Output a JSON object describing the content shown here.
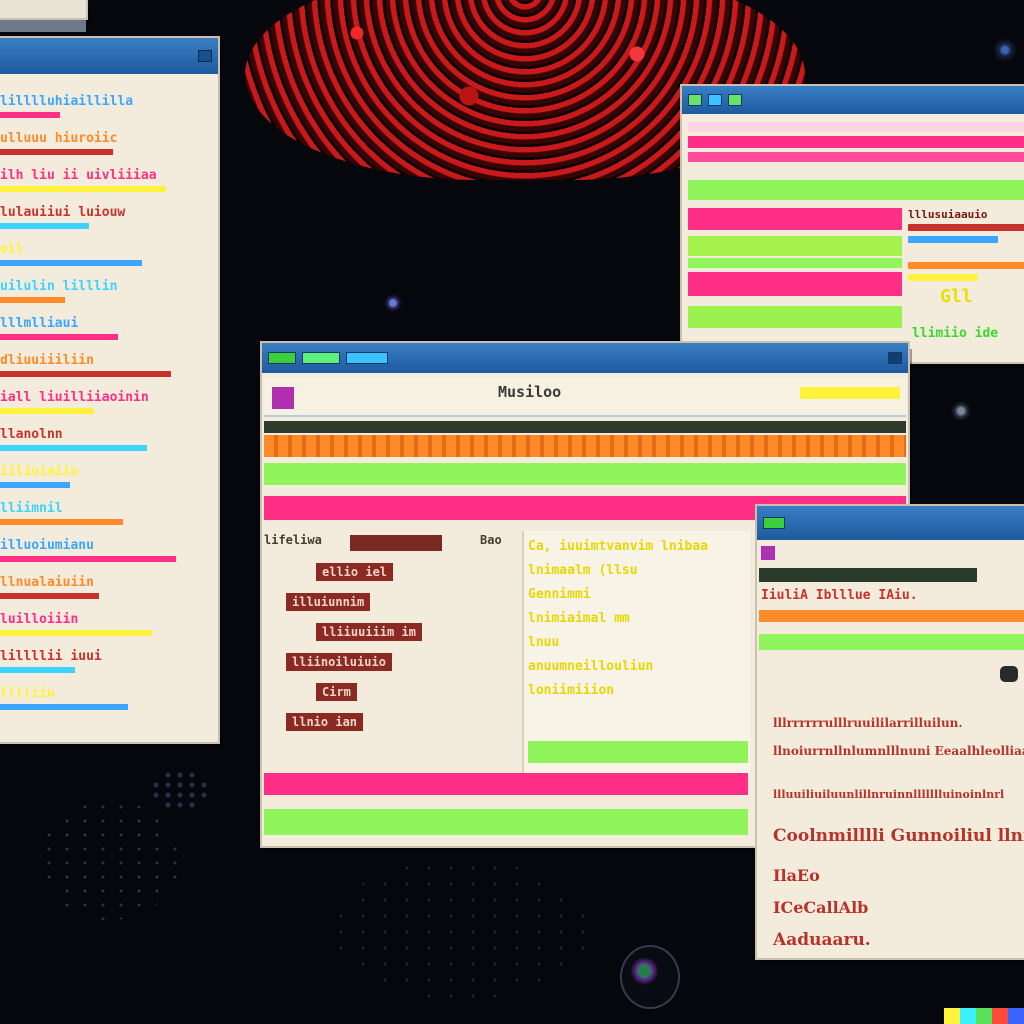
{
  "colors": {
    "desktop": "#05070d",
    "titlebar": "#2a6cb2",
    "pink": "#ff2e86",
    "green": "#8ff55a",
    "yellow": "#fff23a",
    "orange": "#ff8a2a",
    "red": "#c8322c",
    "cream": "#f3ecdc",
    "blue_text": "#3aa6ff"
  },
  "center_window": {
    "header_text": "Musiloo",
    "left_label": "lifeliwa",
    "right_label": "Bao",
    "yellow_rows": [
      "Ca, iuuimtvanvim lnibaa",
      "lnimaalm (llsu",
      "Gennimmi",
      "lnimiaimal mm",
      "lnuu",
      "anuumneillouliun",
      "loniimiiion"
    ],
    "red_rows": [
      "ellio iel",
      "illuiunnim",
      "lliiuuiiim im",
      "lliinoiluiuio",
      "Cirm",
      "llnio ian"
    ]
  },
  "right_top_window": {
    "label_1": "lllusuiaauio",
    "label_2": "Gll",
    "label_3": "llimiio ide"
  },
  "right_bottom_window": {
    "red_header": "IiuliA Iblllue IAiu.",
    "lines": [
      "lllrrrrrrulllruuililarrilluilun.",
      "llnoiurrnllnlumnlllnuni Eeaalhleolliaa",
      "llluuiliuiluunlillnruinnllllllluinoinlnrl",
      "Coolnmilllli Gunnoiliul llnmllaa",
      "IlaEo",
      "ICeCallAlb",
      "Aaduaaru."
    ]
  },
  "left_window": {
    "lines": [
      "lilllluhiaillilla",
      "ulluuu hiuroiic",
      "ilh liu ii uivliiiaa",
      "lulauiiui luiouw",
      "oll",
      "uilulin lilllin",
      "lllmlliaui",
      "dliuuiiiliin",
      "iall liuilliiaoinin",
      "llanolnn",
      "iiliuiaiio",
      "lliimnil",
      "illuoiumianu",
      "llnualaiuiin",
      "luilloiiin",
      "lillllii iuui",
      "lllliiu"
    ]
  }
}
